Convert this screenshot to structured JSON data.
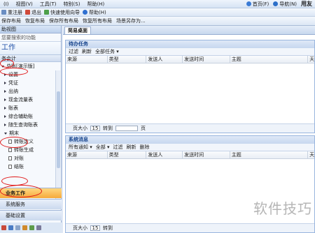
{
  "menubar": {
    "items": [
      "(I)",
      "视图(V)",
      "工具(T)",
      "特别(S)",
      "帮助(H)"
    ],
    "right": {
      "home": "首页(F)",
      "nav": "导航(N)",
      "user": "用友"
    }
  },
  "toolbar1": {
    "items": [
      "重注册",
      "退出",
      "快速使用向导",
      "帮助(H)"
    ]
  },
  "toolbar2": {
    "items": [
      "保存布局",
      "恢复布局",
      "保存所有布局",
      "恢复所有布局",
      "场景另存为..."
    ]
  },
  "left": {
    "header": "助视图",
    "search_placeholder": "您要搜索的功能",
    "title": "工作",
    "group": "务会计",
    "tree": [
      {
        "label": "总账[演示版]",
        "type": "open"
      },
      {
        "label": "设置",
        "type": "closed"
      },
      {
        "label": "凭证",
        "type": "closed"
      },
      {
        "label": "出纳",
        "type": "closed"
      },
      {
        "label": "现金流量表",
        "type": "closed"
      },
      {
        "label": "账表",
        "type": "closed"
      },
      {
        "label": "综合辅助账",
        "type": "closed"
      },
      {
        "label": "随生查询账表",
        "type": "closed"
      },
      {
        "label": "期末",
        "type": "open"
      },
      {
        "label": "转账定义",
        "type": "leaf"
      },
      {
        "label": "转账生成",
        "type": "leaf"
      },
      {
        "label": "对账",
        "type": "leaf"
      },
      {
        "label": "结账",
        "type": "leaf"
      }
    ],
    "categories": [
      "业务工作",
      "系统服务",
      "基础设置"
    ]
  },
  "main": {
    "tab": "简易桌面",
    "todo": {
      "title": "待办任务",
      "actions": [
        "过滤",
        "刷新",
        "全部任务 ▾"
      ],
      "columns": [
        "来源",
        "类型",
        "发送人",
        "发送时间",
        "主题",
        "天"
      ],
      "pager": {
        "page_size_label": "页大小",
        "page_size": "15",
        "goto": "转到",
        "page": "页"
      }
    },
    "messages": {
      "title": "系统消息",
      "actions": [
        "所有通知 ▾",
        "全部 ▾",
        "过滤",
        "刷新",
        "删除"
      ],
      "columns": [
        "来源",
        "类型",
        "发送人",
        "发送时间",
        "主题",
        "天"
      ],
      "pager": {
        "page_size_label": "页大小",
        "page_size": "15",
        "goto": "转到"
      }
    }
  },
  "watermark": "软件技巧",
  "colors": {
    "accent": "#15428b",
    "active_tab": "#f5a93c",
    "annotation": "#e01818"
  }
}
